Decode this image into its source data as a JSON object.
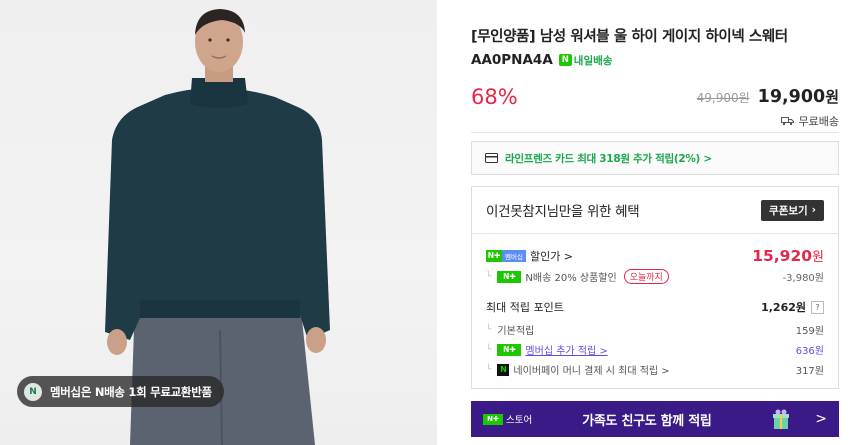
{
  "photo": {
    "badge_icon": "N",
    "badge_text": "멤버십은 N배송 1회 무료교환반품"
  },
  "product": {
    "title": "[무인양품] 남성 워셔블 울 하이 게이지 하이넥 스웨터",
    "model": "AA0PNA4A",
    "delivery_badge": "내일배송",
    "discount": "68%",
    "original_price": "49,900원",
    "price": "19,900",
    "price_unit": "원",
    "shipping": "무료배송"
  },
  "card_promo": "라인프렌즈 카드 최대 318원 추가 적립(2%) >",
  "benefit": {
    "title": "이건못참지님만을 위한 혜택",
    "coupon_button": "쿠폰보기",
    "sale_label": "할인가 >",
    "sale_price": "15,920",
    "sale_unit": "원",
    "n_discount_label": "N배송 20% 상품할인",
    "n_discount_badge": "오늘까지",
    "n_discount_amount": "-3,980원",
    "points_label": "최대 적립 포인트",
    "points_value": "1,262원",
    "help": "?",
    "basic_label": "기본적립",
    "basic_value": "159원",
    "membership_label": "멤버십 추가 적립 >",
    "membership_value": "636원",
    "npay_label": "네이버페이 머니 결제 시 최대 적립 >",
    "npay_value": "317원"
  },
  "store_bar": {
    "store_label": "스토어",
    "text": "가족도 친구도 함께 적립",
    "chevron": ">"
  },
  "colors": {
    "accent_red": "#e4274b",
    "naver_green": "#1ec800",
    "store_purple": "#3a1a86",
    "link_purple": "#6b4bdb"
  }
}
